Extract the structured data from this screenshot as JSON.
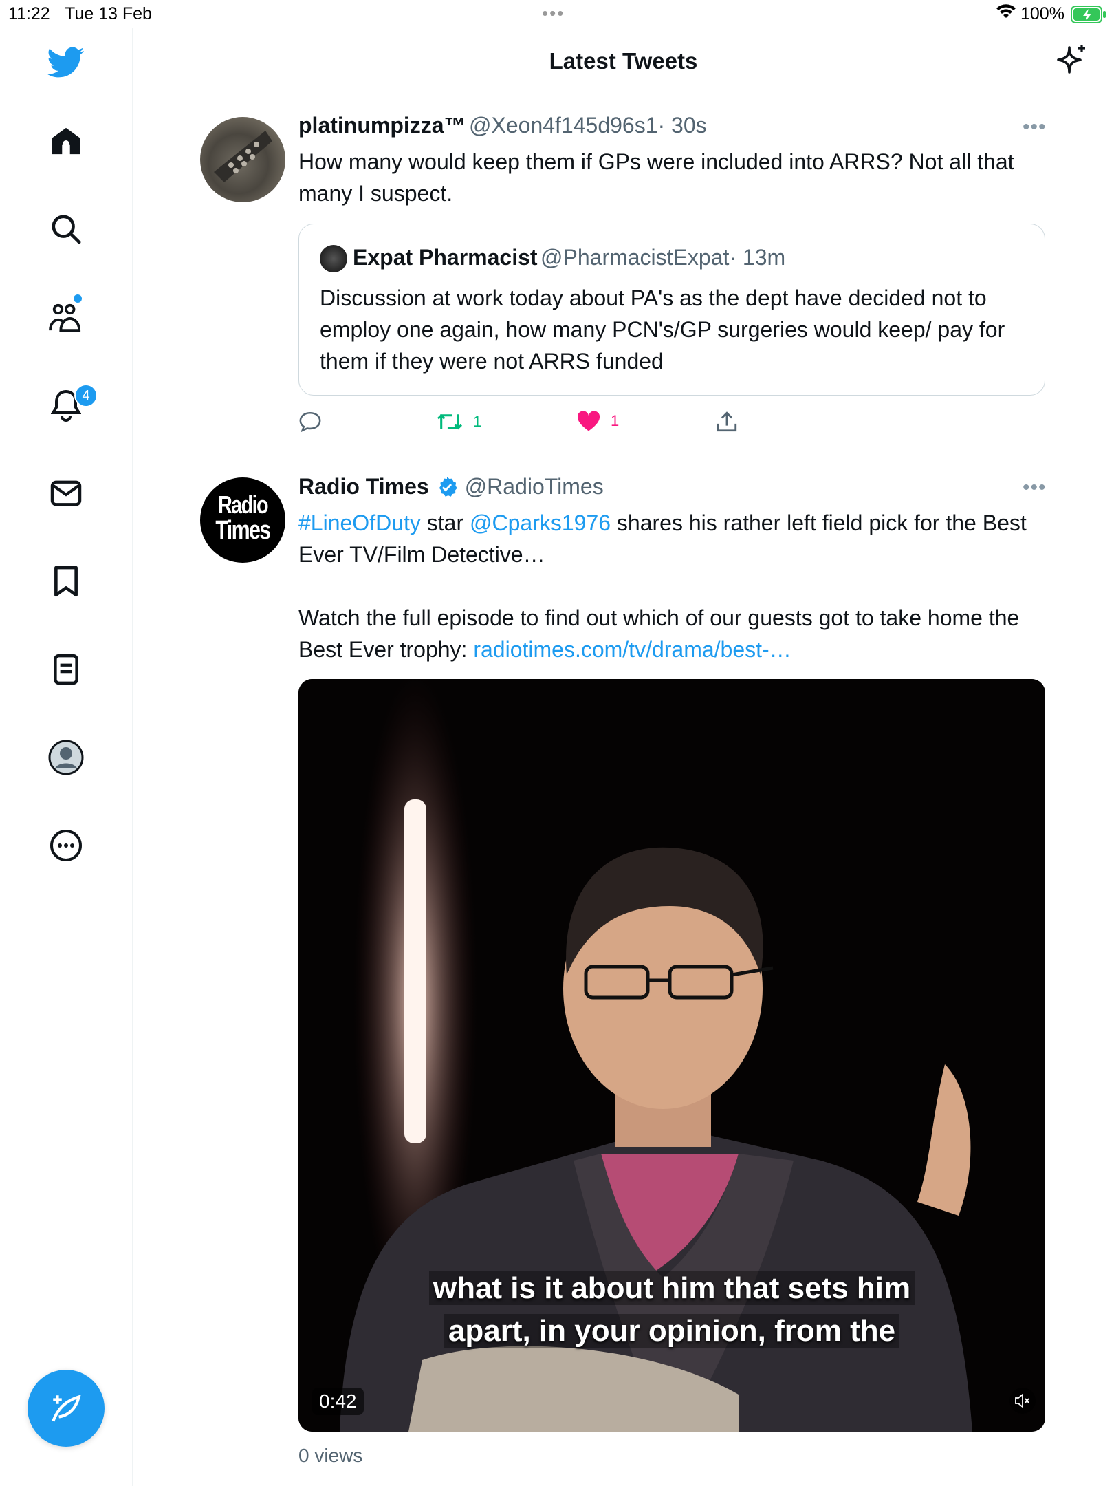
{
  "status_bar": {
    "time": "11:22",
    "date": "Tue 13 Feb",
    "battery": "100%"
  },
  "header": {
    "title": "Latest Tweets"
  },
  "sidebar": {
    "notifications_badge": "4",
    "icons": [
      "twitter-logo-icon",
      "home-icon",
      "search-icon",
      "communities-icon",
      "notifications-icon",
      "messages-icon",
      "bookmarks-icon",
      "lists-icon",
      "profile-icon",
      "more-icon"
    ]
  },
  "tweets": [
    {
      "name": "platinumpizza™",
      "handle": "@Xeon4f145d96s1",
      "time": "· 30s",
      "text": "How many would keep them if GPs were included into ARRS? Not all that many I suspect.",
      "quote": {
        "name": "Expat Pharmacist",
        "handle": "@PharmacistExpat",
        "time": "· 13m",
        "text": "Discussion at work today about PA's as the dept have decided not to employ one again, how many PCN's/GP surgeries would keep/ pay for them if they were not ARRS funded"
      },
      "retweets": "1",
      "likes": "1"
    },
    {
      "name": "Radio Times",
      "handle": "@RadioTimes",
      "verified": true,
      "text_hashtag": "#LineOfDuty",
      "text_star": " star ",
      "text_mention": "@Cparks1976",
      "text_rest": " shares his rather left field pick for the Best Ever TV/Film Detective…",
      "text_para2": "Watch the full episode to find out which of our guests got to take home the Best Ever trophy: ",
      "text_link": "radiotimes.com/tv/drama/best-…",
      "avatar_text_line1": "Radio",
      "avatar_text_line2": "Times",
      "video": {
        "caption_line1": "what is it about him that sets him",
        "caption_line2": "apart, in your opinion, from the",
        "duration": "0:42"
      },
      "views": "0 views"
    }
  ],
  "colors": {
    "accent": "#1d9bf0",
    "retweet": "#00ba7c",
    "like": "#f91880",
    "secondary_text": "#536471"
  }
}
